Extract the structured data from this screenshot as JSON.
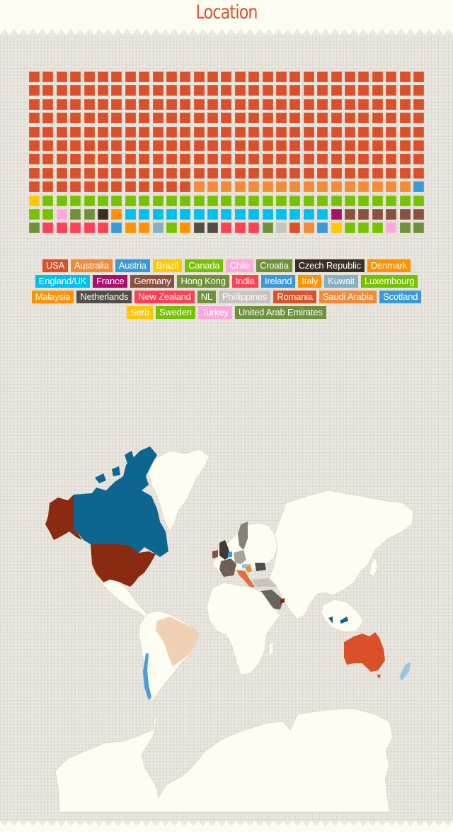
{
  "header": {
    "title": "Location"
  },
  "chart_data": {
    "type": "waffle",
    "title": "Location",
    "grid": {
      "columns": 29,
      "rows": 12,
      "unit": "respondent"
    },
    "legend_placement": "bottom-center",
    "categories": [
      {
        "name": "USA",
        "count": 244,
        "color": "#d9502a"
      },
      {
        "name": "Australia",
        "count": 16,
        "color": "#f28a36"
      },
      {
        "name": "Austria",
        "count": 1,
        "color": "#389ad6"
      },
      {
        "name": "Brazil",
        "count": 1,
        "color": "#ffc800"
      },
      {
        "name": "Canada",
        "count": 30,
        "color": "#76c200"
      },
      {
        "name": "Chile",
        "count": 1,
        "color": "#ffa8dc"
      },
      {
        "name": "Croatia",
        "count": 2,
        "color": "#6e913a"
      },
      {
        "name": "Czech Republic",
        "count": 1,
        "color": "#3b2e22"
      },
      {
        "name": "Denmark",
        "count": 1,
        "color": "#ff9200"
      },
      {
        "name": "England/UK",
        "count": 15,
        "color": "#00c0f0"
      },
      {
        "name": "France",
        "count": 1,
        "color": "#a6106e"
      },
      {
        "name": "Germany",
        "count": 6,
        "color": "#8a5040"
      },
      {
        "name": "Hong Kong",
        "count": 1,
        "color": "#6e913a"
      },
      {
        "name": "India",
        "count": 5,
        "color": "#ff4055"
      },
      {
        "name": "Ireland",
        "count": 1,
        "color": "#389ad6"
      },
      {
        "name": "Italy",
        "count": 2,
        "color": "#ff9200"
      },
      {
        "name": "Kuwait",
        "count": 1,
        "color": "#88aec4"
      },
      {
        "name": "Luxembourg",
        "count": 1,
        "color": "#76c200"
      },
      {
        "name": "Malaysia",
        "count": 1,
        "color": "#ff9200"
      },
      {
        "name": "Netherlands",
        "count": 2,
        "color": "#514e48"
      },
      {
        "name": "New Zealand",
        "count": 3,
        "color": "#ff4055"
      },
      {
        "name": "NL",
        "count": 1,
        "color": "#6e913a"
      },
      {
        "name": "Phillippines",
        "count": 1,
        "color": "#c6c4c0"
      },
      {
        "name": "Romania",
        "count": 1,
        "color": "#d9502a"
      },
      {
        "name": "Saudi Arabia",
        "count": 1,
        "color": "#f28a36"
      },
      {
        "name": "Scotland",
        "count": 1,
        "color": "#389ad6"
      },
      {
        "name": "Serb",
        "count": 1,
        "color": "#ffc800"
      },
      {
        "name": "Sweden",
        "count": 3,
        "color": "#76c200"
      },
      {
        "name": "Turkey",
        "count": 1,
        "color": "#ffa8dc"
      },
      {
        "name": "United Arab Emirates",
        "count": 2,
        "color": "#6e913a"
      }
    ]
  },
  "map": {
    "highlighted": [
      {
        "region": "USA",
        "color": "#8a2a10"
      },
      {
        "region": "Alaska",
        "color": "#8a2a10"
      },
      {
        "region": "Canada",
        "color": "#0e6690"
      },
      {
        "region": "Brazil",
        "color": "#f2d0b4"
      },
      {
        "region": "Chile",
        "color": "#4a9ed8"
      },
      {
        "region": "Australia",
        "color": "#d9502a"
      },
      {
        "region": "New Zealand",
        "color": "#9cc4dc"
      },
      {
        "region": "Malaysia",
        "color": "#0e6690"
      },
      {
        "region": "UK",
        "color": "#3f3a38"
      },
      {
        "region": "Ireland",
        "color": "#8a5040"
      },
      {
        "region": "France",
        "color": "#6e5e58"
      },
      {
        "region": "Germany",
        "color": "#a8a29c"
      },
      {
        "region": "Sweden",
        "color": "#8a807a"
      },
      {
        "region": "Italy",
        "color": "#e07040"
      },
      {
        "region": "Romania",
        "color": "#514e48"
      },
      {
        "region": "Turkey",
        "color": "#c6c4c0"
      },
      {
        "region": "Saudi Arabia",
        "color": "#6a6460"
      },
      {
        "region": "Netherlands",
        "color": "#1aa8e8"
      },
      {
        "region": "Austria",
        "color": "#9cc4dc"
      },
      {
        "region": "Croatia",
        "color": "#f28a36"
      },
      {
        "region": "UAE",
        "color": "#8a2a10"
      }
    ],
    "land_color": "#fdfdf1"
  }
}
